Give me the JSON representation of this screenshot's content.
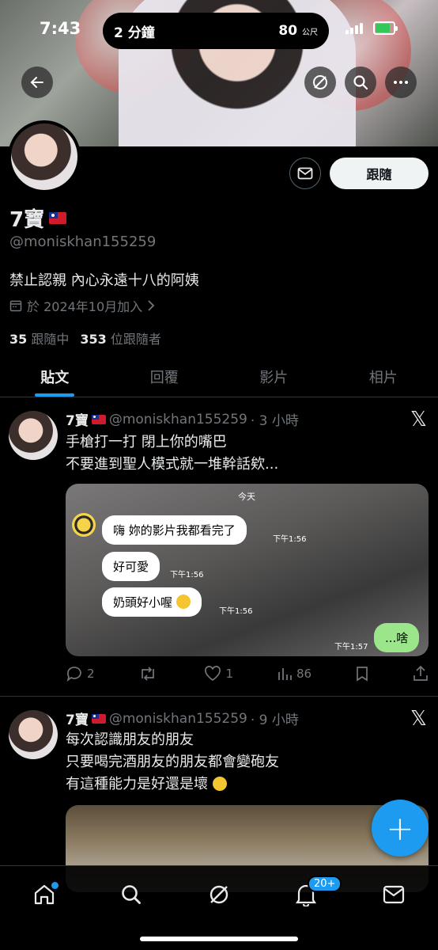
{
  "status_bar": {
    "time": "7:43",
    "island_left": "2 分鐘",
    "island_right_value": "80",
    "island_right_unit": "公尺"
  },
  "profile": {
    "name": "7寶",
    "handle": "@moniskhan155259",
    "bio": "禁止認親 內心永遠十八的阿姨",
    "joined": "於 2024年10月加入",
    "following_count": "35",
    "following_label": "跟隨中",
    "followers_count": "353",
    "followers_label": "位跟隨者",
    "follow_button": "跟隨"
  },
  "tabs": [
    {
      "label": "貼文",
      "active": true
    },
    {
      "label": "回覆",
      "active": false
    },
    {
      "label": "影片",
      "active": false
    },
    {
      "label": "相片",
      "active": false
    }
  ],
  "posts": [
    {
      "name": "7寶",
      "handle": "@moniskhan155259",
      "time": "· 3 小時",
      "lines": [
        "手槍打一打 閉上你的嘴巴",
        "不要進到聖人模式就一堆幹話欸..."
      ],
      "chat": {
        "today": "今天",
        "messages": [
          {
            "text": "嗨 妳的影片我都看完了",
            "time": "下午1:56"
          },
          {
            "text": "好可愛",
            "time": "下午1:56"
          },
          {
            "text": "奶頭好小喔",
            "time": "下午1:56"
          }
        ],
        "reply": {
          "text": "...啥",
          "time": "下午1:57"
        }
      },
      "replies": "2",
      "reposts": "",
      "likes": "1",
      "views": "86"
    },
    {
      "name": "7寶",
      "handle": "@moniskhan155259",
      "time": "· 9 小時",
      "lines": [
        "每次認識朋友的朋友",
        "只要喝完酒朋友的朋友都會變砲友",
        "有這種能力是好還是壞"
      ]
    }
  ],
  "nav": {
    "notifications_badge": "20+"
  },
  "colors": {
    "accent": "#1d9bf0",
    "background": "#000000",
    "secondary_text": "#71767b"
  },
  "icons": [
    "back-icon",
    "grok-icon",
    "search-icon",
    "more-icon",
    "mail-icon",
    "calendar-icon",
    "x-logo-icon",
    "reply-icon",
    "repost-icon",
    "like-icon",
    "views-icon",
    "bookmark-icon",
    "share-icon",
    "home-icon",
    "bell-icon",
    "compose-icon"
  ]
}
